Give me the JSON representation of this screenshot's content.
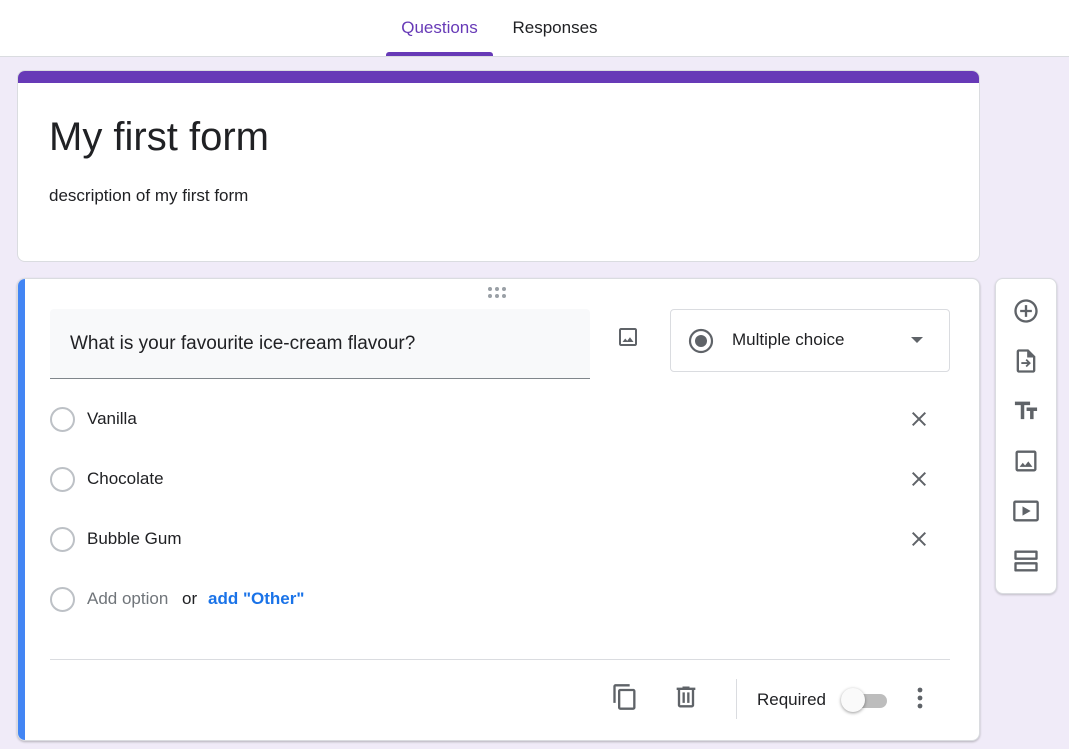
{
  "tabs": {
    "questions": "Questions",
    "responses": "Responses"
  },
  "form": {
    "title": "My first form",
    "description": "description of my first form"
  },
  "question": {
    "text": "What is your favourite ice-cream flavour?",
    "type": "Multiple choice",
    "options": [
      "Vanilla",
      "Chocolate",
      "Bubble Gum"
    ],
    "add_option": "Add option",
    "or_text": "or",
    "add_other": "add \"Other\"",
    "required_label": "Required",
    "required": false
  },
  "colors": {
    "accent": "#673ab7",
    "active_question": "#4285f4",
    "link": "#1a73e8",
    "background": "#f0ebf8"
  },
  "icons": {
    "question_image": "image-icon",
    "type_radio": "radio-checked-icon",
    "remove": "close-icon",
    "copy": "copy-icon",
    "delete": "trash-icon",
    "more": "more-vert-icon",
    "toolbar": [
      "add-circle-icon",
      "import-questions-icon",
      "title-text-icon",
      "image-icon",
      "video-icon",
      "section-icon"
    ]
  }
}
